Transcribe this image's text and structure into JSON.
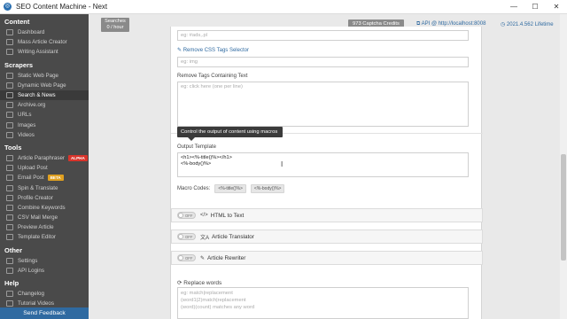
{
  "window": {
    "title": "SEO Content Machine - Next",
    "minimize": "—",
    "maximize": "☐",
    "close": "✕"
  },
  "sidebar": {
    "sections": [
      {
        "header": "Content",
        "items": [
          {
            "label": "Dashboard",
            "icon": "dashboard-icon"
          },
          {
            "label": "Mass Article Creator",
            "icon": "article-icon"
          },
          {
            "label": "Writing Assistant",
            "icon": "pen-icon"
          }
        ]
      },
      {
        "header": "Scrapers",
        "items": [
          {
            "label": "Static Web Page",
            "icon": "web-icon"
          },
          {
            "label": "Dynamic Web Page",
            "icon": "web-icon"
          },
          {
            "label": "Search & News",
            "icon": "search-icon",
            "active": true
          },
          {
            "label": "Archive.org",
            "icon": "archive-icon"
          },
          {
            "label": "URLs",
            "icon": "link-icon"
          },
          {
            "label": "Images",
            "icon": "image-icon"
          },
          {
            "label": "Videos",
            "icon": "video-icon"
          }
        ]
      },
      {
        "header": "Tools",
        "items": [
          {
            "label": "Article Paraphraser",
            "icon": "paraphrase-icon",
            "badge": "ALPHA",
            "badge_color": "#d9342b"
          },
          {
            "label": "Upload Post",
            "icon": "upload-icon"
          },
          {
            "label": "Email Post",
            "icon": "email-icon",
            "badge": "BETA",
            "badge_color": "#e0a020"
          },
          {
            "label": "Spin & Translate",
            "icon": "spin-icon"
          },
          {
            "label": "Profile Creator",
            "icon": "profile-icon"
          },
          {
            "label": "Combine Keywords",
            "icon": "combine-icon"
          },
          {
            "label": "CSV Mail Merge",
            "icon": "csv-icon"
          },
          {
            "label": "Preview Article",
            "icon": "preview-icon"
          },
          {
            "label": "Template Editor",
            "icon": "template-icon"
          }
        ]
      },
      {
        "header": "Other",
        "items": [
          {
            "label": "Settings",
            "icon": "gear-icon"
          },
          {
            "label": "API Logins",
            "icon": "key-icon"
          }
        ]
      },
      {
        "header": "Help",
        "items": [
          {
            "label": "Changelog",
            "icon": "changelog-icon"
          },
          {
            "label": "Tutorial Videos",
            "icon": "video-icon"
          }
        ]
      }
    ],
    "send_feedback": "Send Feedback"
  },
  "topbar": {
    "searches_line1": "Searches",
    "searches_line2": "0 / hour",
    "captcha_credits": "973 Captcha Credits",
    "api_link": "API @ http://localhost:8008",
    "version": "2021.4.562 Lifetime"
  },
  "form": {
    "top_field_placeholder": "eg: #ads,.pl",
    "remove_css_link": "Remove CSS Tags Selector",
    "css_tags_placeholder": "eg: img",
    "remove_tags_label": "Remove Tags Containing Text",
    "remove_tags_placeholder": "eg: click here (one per line)",
    "tooltip": "Control the output of content using macros",
    "output_template_label": "Output Template",
    "output_template_line1": "<h1><%-title()%></h1>",
    "output_template_line2": "<%-body()%>",
    "macro_codes_label": "Macro Codes:",
    "macro_chips": [
      "<%-title()%>",
      "<%-body()%>"
    ],
    "toggles": [
      {
        "state": "OFF",
        "icon_glyph": "</>",
        "label": "HTML to Text"
      },
      {
        "state": "OFF",
        "icon_glyph": "文A",
        "label": "Article Translator"
      },
      {
        "state": "OFF",
        "icon_glyph": "✎",
        "label": "Article Rewriter"
      }
    ],
    "replace_words_label": "Replace words",
    "replace_words_placeholder_1": "eg: match|replacement",
    "replace_words_placeholder_2": "(word1|2)match|replacement",
    "replace_words_placeholder_3": "(word)(count) matches any word"
  },
  "colors": {
    "accent": "#2f6aa1",
    "sidebar_bg": "#4a4a4a",
    "alpha_badge": "#d9342b",
    "beta_badge": "#e0a020"
  }
}
